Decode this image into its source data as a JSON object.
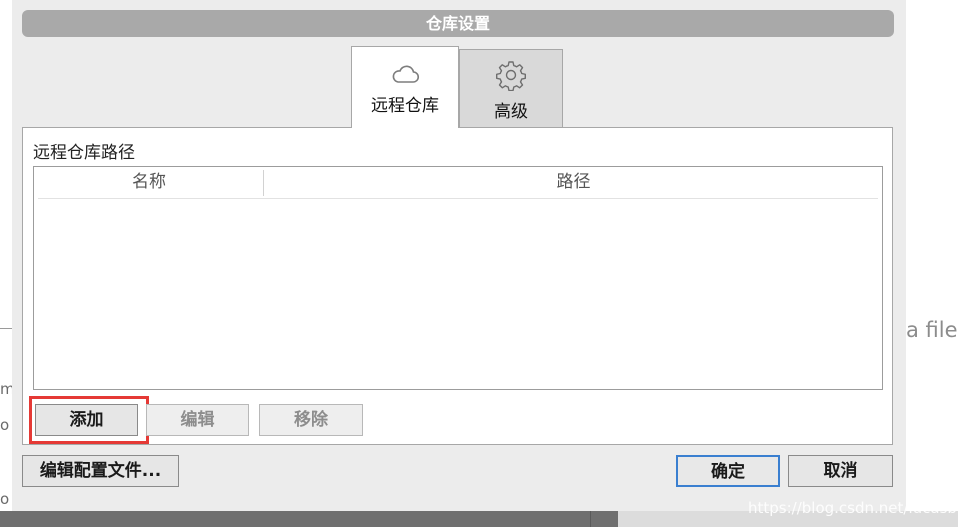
{
  "dialog": {
    "title": "仓库设置",
    "tabs": [
      {
        "label": "远程仓库",
        "icon": "cloud-icon",
        "active": true
      },
      {
        "label": "高级",
        "icon": "gear-icon",
        "active": false
      }
    ],
    "remote_section": {
      "label": "远程仓库路径",
      "columns": [
        "名称",
        "路径"
      ],
      "rows": []
    },
    "buttons": {
      "add": "添加",
      "edit": "编辑",
      "remove": "移除",
      "edit_config": "编辑配置文件...",
      "ok": "确定",
      "cancel": "取消"
    }
  },
  "background": {
    "right_text": "a file",
    "left_chars": [
      "m",
      "o",
      "o"
    ]
  },
  "watermark": "https://blog.csdn.net/lucasbo",
  "colors": {
    "highlight_border": "#e53935",
    "primary_border": "#3a7fd0",
    "titlebar": "#a9a9a9"
  }
}
